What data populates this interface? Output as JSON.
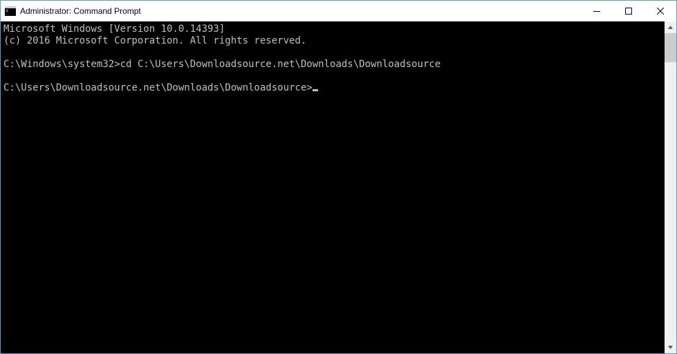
{
  "window": {
    "title": "Administrator: Command Prompt"
  },
  "terminal": {
    "header_line": "Microsoft Windows [Version 10.0.14393]",
    "copyright_line": "(c) 2016 Microsoft Corporation. All rights reserved.",
    "prompt1_prefix": "C:\\Windows\\system32>",
    "prompt1_command": "cd C:\\Users\\Downloadsource.net\\Downloads\\Downloadsource",
    "prompt2_prefix": "C:\\Users\\Downloadsource.net\\Downloads\\Downloadsource>",
    "prompt2_command": ""
  }
}
